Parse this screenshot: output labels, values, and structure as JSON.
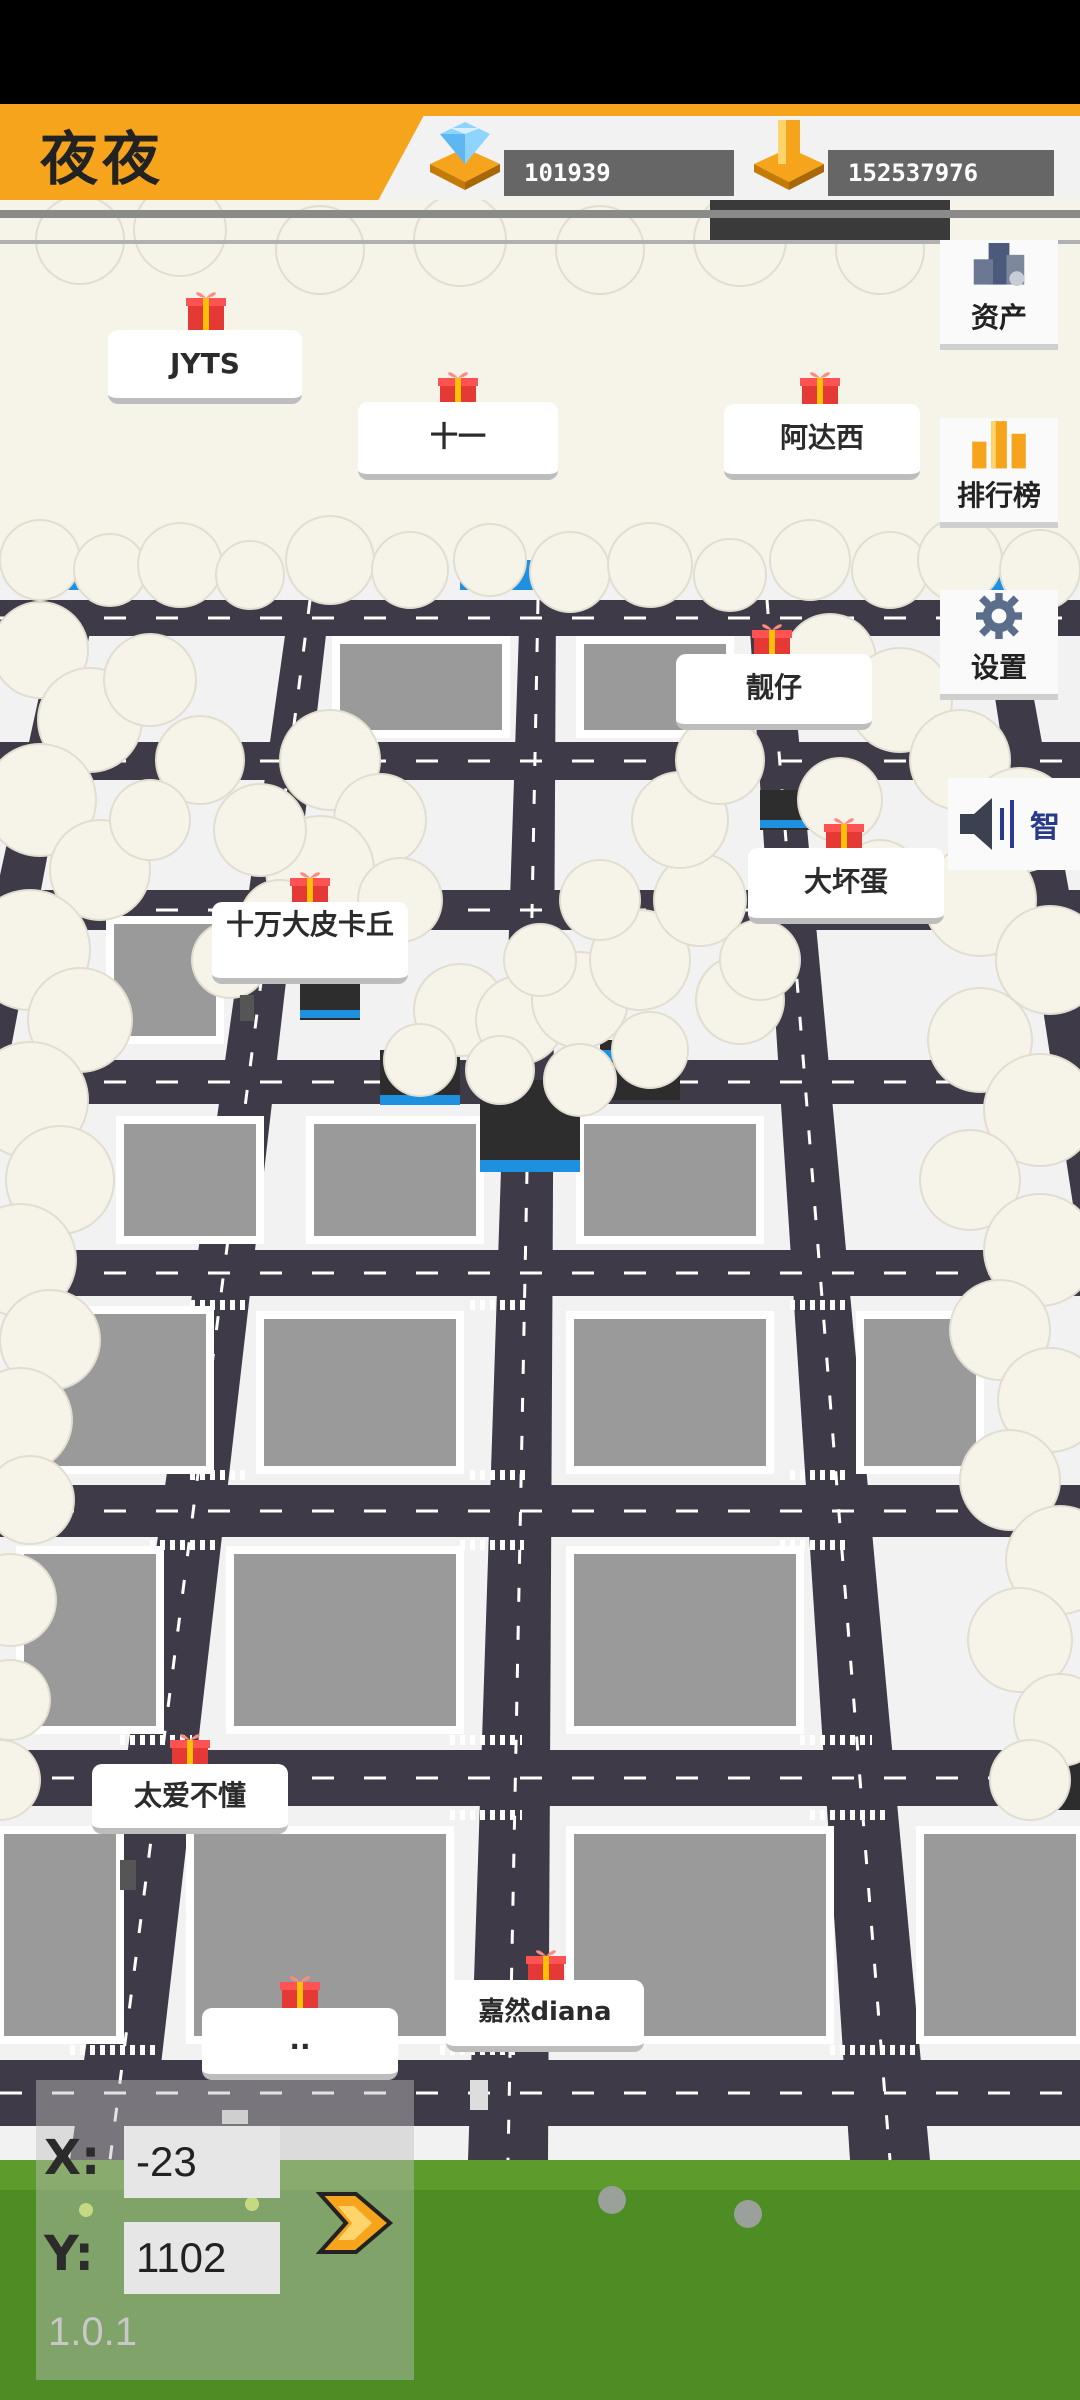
{
  "header": {
    "player_name": "夜夜",
    "diamonds": "101939",
    "gold": "152537976"
  },
  "side_menu": [
    {
      "label": "资产",
      "icon": "assets-buildings-icon"
    },
    {
      "label": "排行榜",
      "icon": "leaderboard-bars-icon"
    },
    {
      "label": "设置",
      "icon": "settings-gear-icon"
    }
  ],
  "speaker": {
    "label": "智"
  },
  "player_labels": [
    "JYTS",
    "十一",
    "阿达西",
    "靓仔",
    "大坏蛋",
    "十万大皮卡丘",
    "太爱不懂",
    "..",
    "嘉然diana"
  ],
  "coords": {
    "x_label": "X:",
    "y_label": "Y:",
    "x_value": "-23",
    "y_value": "1102"
  },
  "version": "1.0.1",
  "colors": {
    "accent": "#f5a41c",
    "road": "#3f3a48",
    "sidewalk": "#f3f3f3",
    "lot": "#9a9a9a",
    "grass": "#4e8d24",
    "cloud": "#f6f3e9"
  }
}
